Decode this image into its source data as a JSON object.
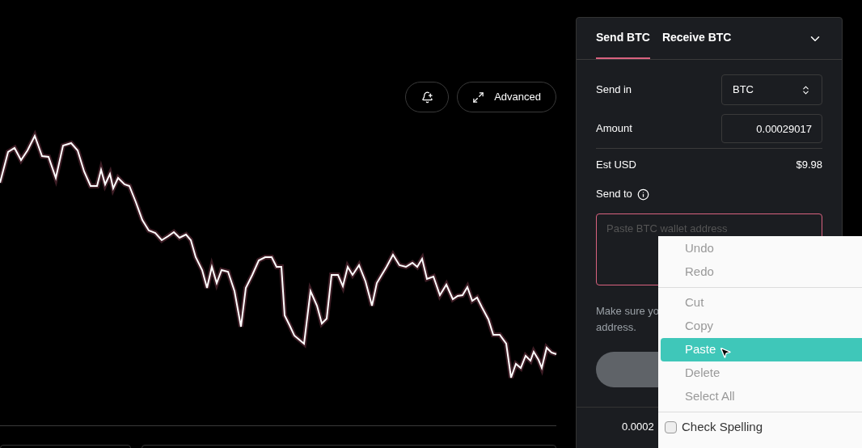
{
  "chart_toolbar": {
    "buttons": [
      {
        "kind": "alert"
      },
      {
        "kind": "expand",
        "label": "Advanced"
      }
    ]
  },
  "panel": {
    "tabs": [
      {
        "label": "Send BTC",
        "selected": true
      },
      {
        "label": "Receive BTC",
        "selected": false
      }
    ],
    "send_in": {
      "label": "Send in",
      "value": "BTC"
    },
    "amount": {
      "label": "Amount",
      "value": "0.00029017"
    },
    "est_usd": {
      "label": "Est USD",
      "value": "$9.98"
    },
    "send_to": {
      "label": "Send to",
      "placeholder": "Paste BTC wallet address"
    },
    "note": [
      "Make sure yo",
      "address."
    ],
    "footer": "0.0002"
  },
  "context_menu": {
    "items": [
      {
        "kind": "item",
        "label": "Undo",
        "selected": false
      },
      {
        "kind": "item",
        "label": "Redo",
        "selected": false
      },
      {
        "kind": "separator"
      },
      {
        "kind": "item",
        "label": "Cut",
        "selected": false
      },
      {
        "kind": "item",
        "label": "Copy",
        "selected": false
      },
      {
        "kind": "item",
        "label": "Paste",
        "selected": true
      },
      {
        "kind": "item",
        "label": "Delete",
        "selected": false
      },
      {
        "kind": "item",
        "label": "Select All",
        "selected": false
      },
      {
        "kind": "separator"
      },
      {
        "kind": "checkbox",
        "label": "Check Spelling",
        "checked": false
      }
    ]
  }
}
